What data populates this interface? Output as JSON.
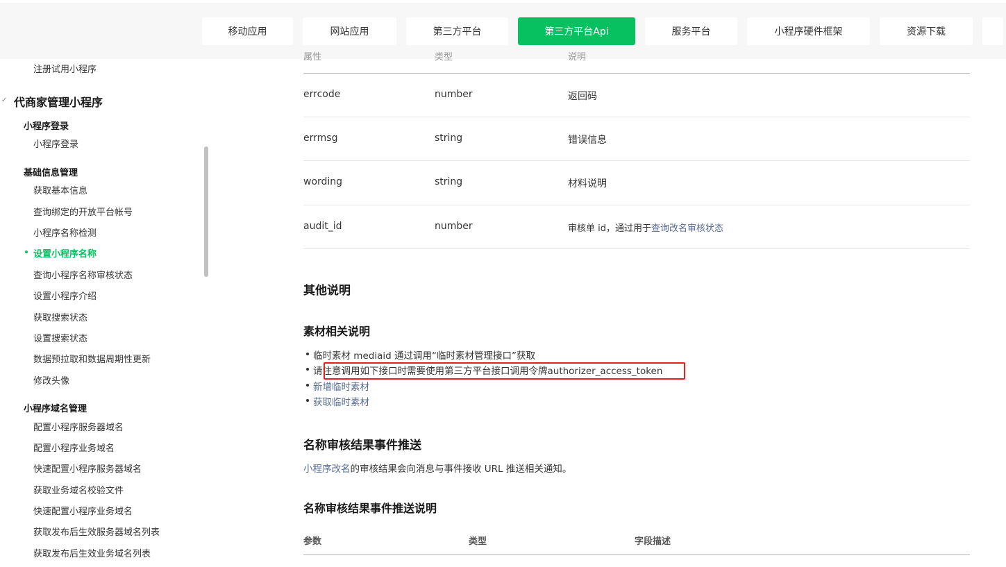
{
  "nav": {
    "tabs": [
      {
        "label": "移动应用"
      },
      {
        "label": "网站应用"
      },
      {
        "label": "第三方平台"
      },
      {
        "label": "第三方平台Api"
      },
      {
        "label": "服务平台"
      },
      {
        "label": "小程序硬件框架"
      },
      {
        "label": "资源下载"
      }
    ],
    "active_index": 3,
    "accent_color": "#07c160"
  },
  "sidebar": {
    "top_item": "注册试用小程序",
    "group_title": "代商家管理小程序",
    "categories": [
      {
        "title": "小程序登录",
        "items": [
          "小程序登录"
        ]
      },
      {
        "title": "基础信息管理",
        "items": [
          "获取基本信息",
          "查询绑定的开放平台帐号",
          "小程序名称检测",
          "设置小程序名称",
          "查询小程序名称审核状态",
          "设置小程序介绍",
          "获取搜索状态",
          "设置搜索状态",
          "数据预拉取和数据周期性更新",
          "修改头像"
        ]
      },
      {
        "title": "小程序域名管理",
        "items": [
          "配置小程序服务器域名",
          "配置小程序业务域名",
          "快速配置小程序服务器域名",
          "获取业务域名校验文件",
          "快速配置小程序业务域名",
          "获取发布后生效服务器域名列表",
          "获取发布后生效业务域名列表"
        ]
      }
    ],
    "active_item": "设置小程序名称"
  },
  "return_table": {
    "headers": [
      "属性",
      "类型",
      "说明"
    ],
    "rows": [
      {
        "name": "errcode",
        "type": "number",
        "desc": "返回码"
      },
      {
        "name": "errmsg",
        "type": "string",
        "desc": "错误信息"
      },
      {
        "name": "wording",
        "type": "string",
        "desc": "材料说明"
      },
      {
        "name": "audit_id",
        "type": "number",
        "desc_prefix": "审核单 id，通过用于",
        "desc_link": "查询改名审核状态"
      }
    ]
  },
  "other": {
    "title": "其他说明",
    "material_title": "素材相关说明",
    "bullets": [
      "临时素材 mediaid 通过调用“临时素材管理接口”获取",
      "请注意调用如下接口时需要使用第三方平台接口调用令牌authorizer_access_token"
    ],
    "links": [
      "新增临时素材",
      "获取临时素材"
    ]
  },
  "event": {
    "title": "名称审核结果事件推送",
    "desc_link": "小程序改名",
    "desc_rest": "的审核结果会向消息与事件接收 URL 推送相关通知。",
    "detail_title": "名称审核结果事件推送说明",
    "headers": [
      "参数",
      "类型",
      "字段描述"
    ]
  }
}
